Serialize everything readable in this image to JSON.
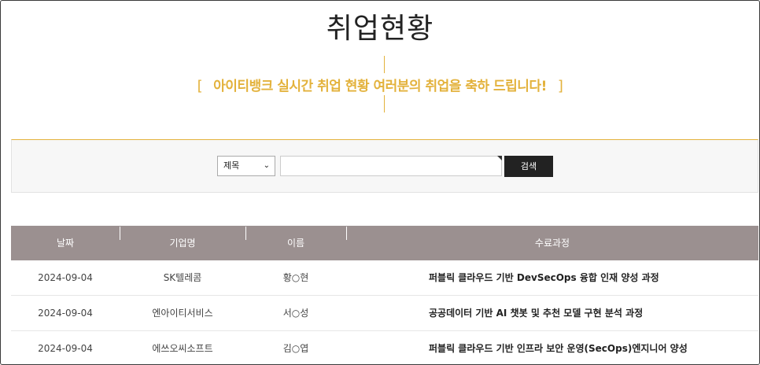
{
  "page": {
    "title": "취업현황",
    "banner_open": "[",
    "banner_text": "아이티뱅크 실시간 취업 현황 여러분의 취업을 축하 드립니다!",
    "banner_close": "]"
  },
  "search": {
    "select_value": "제목",
    "input_value": "",
    "button_label": "검색"
  },
  "table": {
    "headers": [
      "날짜",
      "기업명",
      "이름",
      "수료과정"
    ],
    "rows": [
      {
        "date": "2024-09-04",
        "company": "SK텔레콤",
        "name": "황○현",
        "course": "퍼블릭 클라우드 기반 DevSecOps 융합 인재 양성 과정"
      },
      {
        "date": "2024-09-04",
        "company": "엔아이티서비스",
        "name": "서○성",
        "course": "공공데이터 기반 AI 챗봇 및 추천 모델 구현 분석 과정"
      },
      {
        "date": "2024-09-04",
        "company": "에쓰오씨소프트",
        "name": "김○엽",
        "course": "퍼블릭 클라우드 기반 인프라 보안 운영(SecOps)엔지니어 양성"
      }
    ]
  }
}
